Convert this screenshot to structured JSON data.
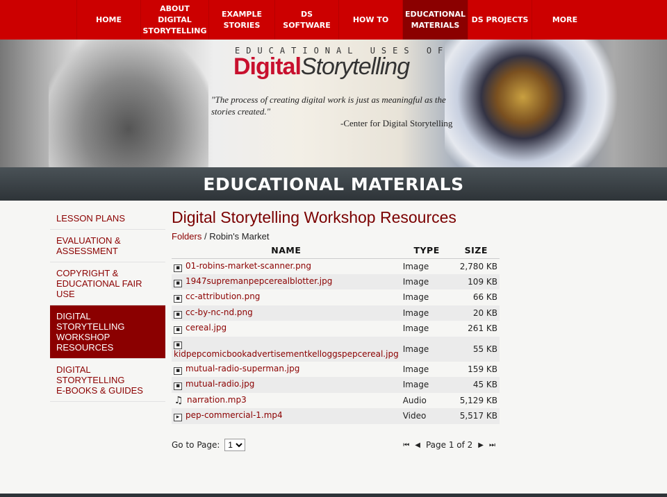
{
  "nav": [
    {
      "label": "HOME",
      "active": false
    },
    {
      "label": "ABOUT\nDIGITAL\nSTORYTELLING",
      "active": false
    },
    {
      "label": "EXAMPLE\nSTORIES",
      "active": false
    },
    {
      "label": "DS\nSOFTWARE",
      "active": false
    },
    {
      "label": "HOW TO",
      "active": false
    },
    {
      "label": "EDUCATIONAL\nMATERIALS",
      "active": true
    },
    {
      "label": "DS PROJECTS",
      "active": false
    },
    {
      "label": "MORE",
      "active": false
    }
  ],
  "banner": {
    "top": "EDUCATIONAL USES OF",
    "title_a": "Digital",
    "title_b": "Storytelling",
    "quote": "\"The process of creating digital work is just as meaningful as the stories created.\"",
    "attribution": "-Center for Digital Storytelling"
  },
  "section_title": "EDUCATIONAL MATERIALS",
  "sidebar": [
    {
      "label": "LESSON PLANS",
      "active": false
    },
    {
      "label": "EVALUATION &\nASSESSMENT",
      "active": false
    },
    {
      "label": "COPYRIGHT &\nEDUCATIONAL FAIR USE",
      "active": false
    },
    {
      "label": "DIGITAL STORYTELLING\nWORKSHOP RESOURCES",
      "active": true
    },
    {
      "label": "DIGITAL STORYTELLING\nE-BOOKS & GUIDES",
      "active": false
    }
  ],
  "main": {
    "title": "Digital Storytelling Workshop Resources",
    "breadcrumb": {
      "root": "Folders",
      "sep": "/",
      "current": "Robin's Market"
    },
    "columns": [
      "NAME",
      "TYPE",
      "SIZE"
    ],
    "files": [
      {
        "name": "01-robins-market-scanner.png",
        "type": "Image",
        "size": "2,780 KB",
        "icon": "image-icon"
      },
      {
        "name": "1947supremanpepcerealblotter.jpg",
        "type": "Image",
        "size": "109 KB",
        "icon": "image-icon"
      },
      {
        "name": "cc-attribution.png",
        "type": "Image",
        "size": "66 KB",
        "icon": "image-icon"
      },
      {
        "name": "cc-by-nc-nd.png",
        "type": "Image",
        "size": "20 KB",
        "icon": "image-icon"
      },
      {
        "name": "cereal.jpg",
        "type": "Image",
        "size": "261 KB",
        "icon": "image-icon"
      },
      {
        "name": "kidpepcomicbookadvertisementkelloggspepcereal.jpg",
        "type": "Image",
        "size": "55 KB",
        "icon": "image-icon"
      },
      {
        "name": "mutual-radio-superman.jpg",
        "type": "Image",
        "size": "159 KB",
        "icon": "image-icon"
      },
      {
        "name": "mutual-radio.jpg",
        "type": "Image",
        "size": "45 KB",
        "icon": "image-icon"
      },
      {
        "name": "narration.mp3",
        "type": "Audio",
        "size": "5,129 KB",
        "icon": "music-icon"
      },
      {
        "name": "pep-commercial-1.mp4",
        "type": "Video",
        "size": "5,517 KB",
        "icon": "video-icon"
      }
    ],
    "pager": {
      "goto_label": "Go to Page:",
      "selected": "1",
      "page_text": "Page 1 of 2"
    }
  },
  "colors": {
    "nav": "#cc0000",
    "active": "#8b0000",
    "link": "#8b0000",
    "titlebar": "#3a4146"
  }
}
